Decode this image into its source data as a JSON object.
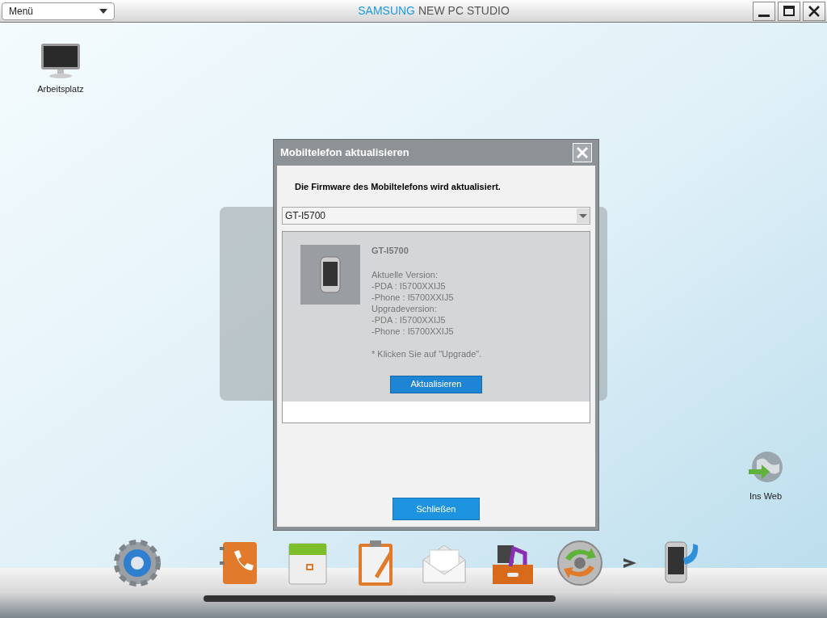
{
  "app": {
    "menu_label": "Menü",
    "title_brand": "SAMSUNG",
    "title_rest": "NEW PC STUDIO"
  },
  "desktop_icons": [
    {
      "kind": "monitor",
      "label": "Arbeitsplatz"
    },
    {
      "kind": "globe",
      "label": "Ins Web"
    }
  ],
  "dialog": {
    "title": "Mobiltelefon aktualisieren",
    "heading": "Die Firmware des Mobiltelefons wird aktualisiert.",
    "device_select": "GT-I5700",
    "device_name": "GT-I5700",
    "info_lines": [
      "Aktuelle Version:",
      "-PDA : I5700XXIJ5",
      "-Phone : I5700XXIJ5",
      "Upgradeversion:",
      "-PDA : I5700XXIJ5",
      "-Phone : I5700XXIJ5"
    ],
    "hint": "* Klicken Sie auf \"Upgrade\".",
    "update_button": "Aktualisieren",
    "close_button": "Schließen"
  },
  "dock": [
    {
      "kind": "settings"
    },
    {
      "kind": "contacts"
    },
    {
      "kind": "calendar"
    },
    {
      "kind": "memo"
    },
    {
      "kind": "mail"
    },
    {
      "kind": "media"
    },
    {
      "kind": "sync"
    },
    {
      "kind": "more"
    },
    {
      "kind": "phone"
    }
  ]
}
